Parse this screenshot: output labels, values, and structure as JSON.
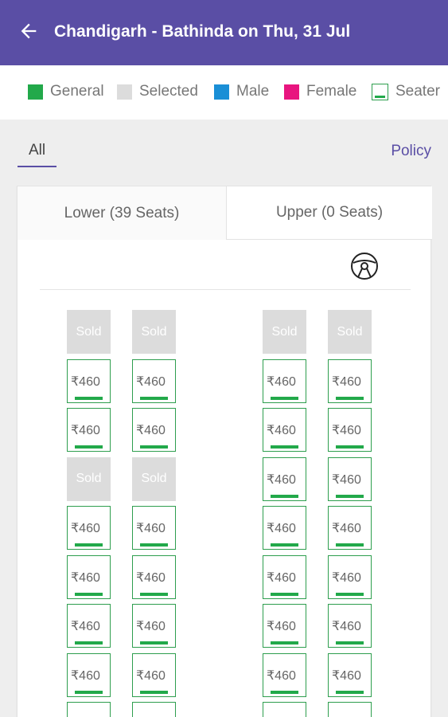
{
  "header": {
    "title": "Chandigarh - Bathinda on Thu, 31 Jul",
    "back_icon": "arrow-left-icon"
  },
  "legend": [
    {
      "label": "General",
      "color": "#22a94a",
      "kind": "swatch"
    },
    {
      "label": "Selected",
      "color": "#dcdcdc",
      "kind": "swatch"
    },
    {
      "label": "Male",
      "color": "#1a8fd6",
      "kind": "swatch"
    },
    {
      "label": "Female",
      "color": "#e8157f",
      "kind": "swatch"
    },
    {
      "label": "Seater",
      "color": "#22a94a",
      "kind": "seater"
    }
  ],
  "filter": {
    "tab_all": "All",
    "policy": "Policy"
  },
  "deck": {
    "lower_tab": "Lower (39 Seats)",
    "upper_tab": "Upper (0 Seats)",
    "steering_icon": "steering-wheel-icon"
  },
  "seat_labels": {
    "sold": "Sold",
    "price": "₹460"
  },
  "seat_rows": [
    [
      "sold",
      "sold",
      "sold",
      "sold"
    ],
    [
      "avail",
      "avail",
      "avail",
      "avail"
    ],
    [
      "avail",
      "avail",
      "avail",
      "avail"
    ],
    [
      "sold",
      "sold",
      "avail",
      "avail"
    ],
    [
      "avail",
      "avail",
      "avail",
      "avail"
    ],
    [
      "avail",
      "avail",
      "avail",
      "avail"
    ],
    [
      "avail",
      "avail",
      "avail",
      "avail"
    ],
    [
      "avail",
      "avail",
      "avail",
      "avail"
    ],
    [
      "avail",
      "avail",
      "avail",
      "avail"
    ]
  ],
  "colors": {
    "brand": "#5a4ea5",
    "available_border": "#2e9e4e",
    "sold": "#dcdcdc"
  }
}
